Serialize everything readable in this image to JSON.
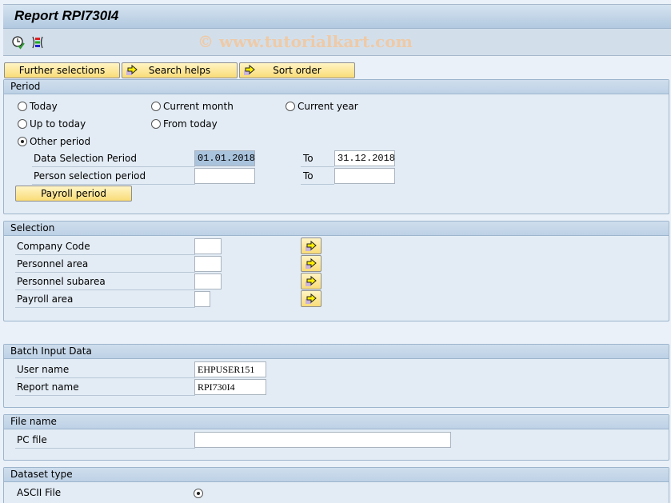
{
  "window": {
    "title": "Report RPI730I4",
    "watermark": "© www.tutorialkart.com"
  },
  "toolbar": {
    "icons": [
      "execute-clock-icon",
      "variant-selection-icon"
    ]
  },
  "buttons": {
    "further_selections": "Further selections",
    "search_helps": "Search helps",
    "sort_order": "Sort order"
  },
  "period": {
    "title": "Period",
    "radios": [
      {
        "label": "Today",
        "selected": false
      },
      {
        "label": "Current month",
        "selected": false
      },
      {
        "label": "Current year",
        "selected": false
      },
      {
        "label": "Up to today",
        "selected": false
      },
      {
        "label": "From today",
        "selected": false
      },
      {
        "label": "Other period",
        "selected": true
      }
    ],
    "data_selection_label": "Data Selection Period",
    "data_selection_from": "01.01.2018",
    "data_selection_to": "31.12.2018",
    "person_selection_label": "Person selection period",
    "person_selection_from": "",
    "person_selection_to": "",
    "to_label": "To",
    "payroll_period_button": "Payroll period"
  },
  "selection": {
    "title": "Selection",
    "rows": [
      {
        "label": "Company Code",
        "value": ""
      },
      {
        "label": "Personnel area",
        "value": ""
      },
      {
        "label": "Personnel subarea",
        "value": ""
      },
      {
        "label": "Payroll area",
        "value": ""
      }
    ]
  },
  "batch": {
    "title": "Batch Input Data",
    "user_label": "User name",
    "user_value": "EHPUSER151",
    "report_label": "Report name",
    "report_value": "RPI730I4"
  },
  "file": {
    "title": "File name",
    "pc_file_label": "PC file",
    "pc_file_value": ""
  },
  "dataset": {
    "title": "Dataset type",
    "ascii_label": "ASCII File",
    "ascii_selected": true
  }
}
